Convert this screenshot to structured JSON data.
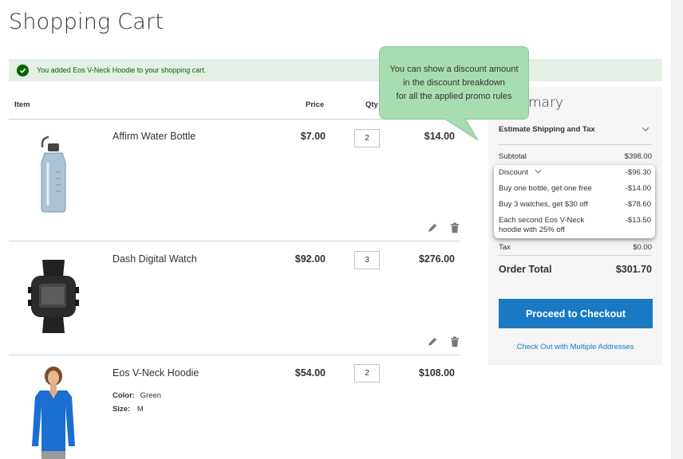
{
  "page": {
    "title": "Shopping Cart"
  },
  "message": {
    "text": "You added Eos V-Neck Hoodie to your shopping cart."
  },
  "table": {
    "headers": {
      "item": "Item",
      "price": "Price",
      "qty": "Qty"
    }
  },
  "items": [
    {
      "name": "Affirm Water Bottle",
      "price": "$7.00",
      "qty": "2",
      "subtotal": "$14.00"
    },
    {
      "name": "Dash Digital Watch",
      "price": "$92.00",
      "qty": "3",
      "subtotal": "$276.00"
    },
    {
      "name": "Eos V-Neck Hoodie",
      "price": "$54.00",
      "qty": "2",
      "subtotal": "$108.00",
      "options": [
        {
          "label": "Color:",
          "value": "Green"
        },
        {
          "label": "Size:",
          "value": "M"
        }
      ]
    }
  ],
  "summary": {
    "title": "mary",
    "estimate": "Estimate Shipping and Tax",
    "subtotal_label": "Subtotal",
    "subtotal_value": "$398.00",
    "tax_label": "Tax",
    "tax_value": "$0.00",
    "total_label": "Order Total",
    "total_value": "$301.70",
    "checkout_label": "Proceed to Checkout",
    "multi_label": "Check Out with Multiple Addresses"
  },
  "discount": {
    "label": "Discount",
    "value": "-$96.30",
    "rules": [
      {
        "label": "Buy one bottle, get one free",
        "value": "-$14.00"
      },
      {
        "label": "Buy 3 watches, get $30 off",
        "value": "-$78.60"
      },
      {
        "label": "Each second Eos V-Neck hoodie with 25% off",
        "value": "-$13.50"
      }
    ]
  },
  "tooltip": {
    "line1": "You can show a discount amount",
    "line2": "in the discount breakdown",
    "line3": "for all the applied promo rules"
  },
  "colors": {
    "primary": "#1979c3",
    "success": "#006400",
    "success_bg": "#e5efe5",
    "tooltip_bg": "#a8dcb1"
  },
  "icons": {
    "success": "check-circle-icon",
    "edit": "pencil-icon",
    "delete": "trash-icon",
    "expand": "chevron-down-icon"
  }
}
